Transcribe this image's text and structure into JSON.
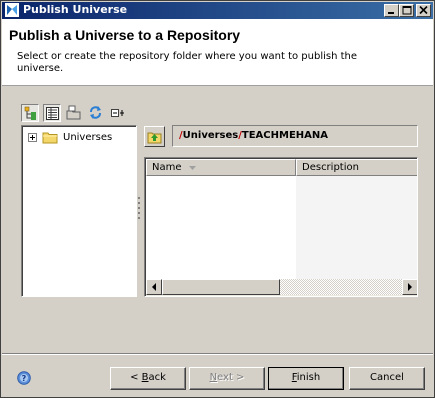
{
  "window": {
    "title": "Publish Universe"
  },
  "header": {
    "title": "Publish a Universe to a Repository",
    "description": "Select or create the repository folder where you want to publish the universe."
  },
  "tree": {
    "toolbar_icons": [
      "show-tree-icon",
      "list-view-icon",
      "folder-view-icon",
      "refresh-icon",
      "collapse-all-icon"
    ],
    "root_label": "Universes"
  },
  "path_bar": {
    "segments": [
      "Universes",
      "TEACHMEHANA"
    ]
  },
  "list": {
    "columns": [
      "Name",
      "Description"
    ]
  },
  "footer": {
    "back": {
      "mnemonic": "B",
      "rest": "ack",
      "prefix": "< "
    },
    "next": {
      "mnemonic": "N",
      "rest": "ext >"
    },
    "finish": {
      "mnemonic": "F",
      "rest": "inish"
    },
    "cancel": "Cancel"
  },
  "colors": {
    "titlebar_start": "#0a246a",
    "titlebar_end": "#3a6ea5",
    "path_separator": "#c00000",
    "dialog_bg": "#d4d0c8"
  }
}
